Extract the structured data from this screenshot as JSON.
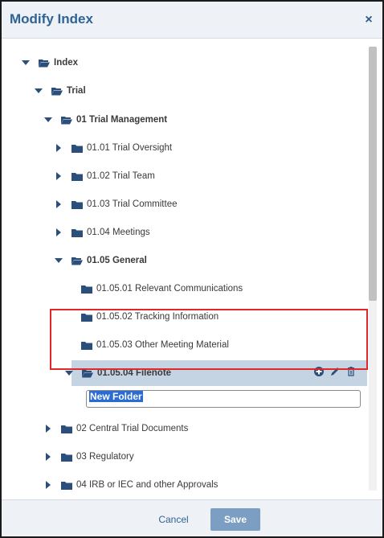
{
  "dialog": {
    "title": "Modify Index",
    "close_icon": "close-icon",
    "close_glyph": "×"
  },
  "tree": {
    "nodes": [
      {
        "label": "Index",
        "expanded": true,
        "bold": true,
        "caret": "down",
        "folder": "open"
      },
      {
        "label": "Trial",
        "expanded": true,
        "bold": true,
        "caret": "down",
        "folder": "open"
      },
      {
        "label": "01 Trial Management",
        "expanded": true,
        "bold": true,
        "caret": "down",
        "folder": "open"
      },
      {
        "label": "01.01 Trial Oversight",
        "expanded": false,
        "bold": false,
        "caret": "right",
        "folder": "closed"
      },
      {
        "label": "01.02 Trial Team",
        "expanded": false,
        "bold": false,
        "caret": "right",
        "folder": "closed"
      },
      {
        "label": "01.03 Trial Committee",
        "expanded": false,
        "bold": false,
        "caret": "right",
        "folder": "closed"
      },
      {
        "label": "01.04 Meetings",
        "expanded": false,
        "bold": false,
        "caret": "right",
        "folder": "closed"
      },
      {
        "label": "01.05 General",
        "expanded": true,
        "bold": true,
        "caret": "down",
        "folder": "open"
      },
      {
        "label": "01.05.01 Relevant Communications",
        "expanded": false,
        "bold": false,
        "caret": "none",
        "folder": "closed"
      },
      {
        "label": "01.05.02 Tracking Information",
        "expanded": false,
        "bold": false,
        "caret": "none",
        "folder": "closed"
      },
      {
        "label": "01.05.03 Other Meeting Material",
        "expanded": false,
        "bold": false,
        "caret": "none",
        "folder": "closed"
      },
      {
        "label": "01.05.04 Filenote",
        "expanded": true,
        "bold": true,
        "caret": "down",
        "folder": "open",
        "selected": true
      },
      {
        "label": "02 Central Trial Documents",
        "expanded": false,
        "bold": false,
        "caret": "right",
        "folder": "closed"
      },
      {
        "label": "03 Regulatory",
        "expanded": false,
        "bold": false,
        "caret": "right",
        "folder": "closed"
      },
      {
        "label": "04 IRB or IEC and other Approvals",
        "expanded": false,
        "bold": false,
        "caret": "right",
        "folder": "closed"
      }
    ],
    "new_folder_value": "New Folder",
    "row_actions": [
      "add-icon",
      "edit-icon",
      "delete-icon"
    ]
  },
  "footer": {
    "cancel_label": "Cancel",
    "save_label": "Save"
  },
  "colors": {
    "accent": "#2e6396",
    "selected_row": "#c5d4e3",
    "highlight_box": "#e3262a",
    "save_button": "#7c9ec2",
    "text_selection": "#2a6cd3"
  }
}
